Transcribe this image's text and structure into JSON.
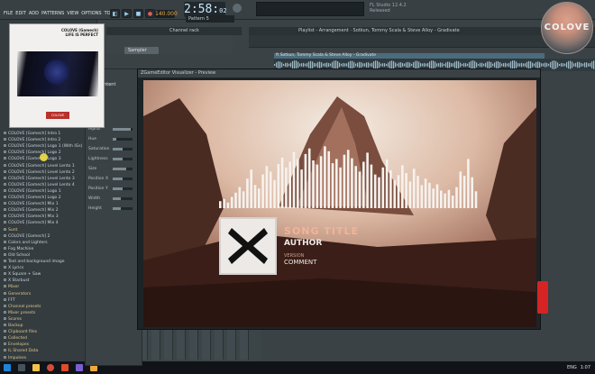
{
  "window": {
    "menu": [
      "FILE",
      "EDIT",
      "ADD",
      "PATTERNS",
      "VIEW",
      "OPTIONS",
      "TOOLS",
      "?"
    ],
    "tempo": "140.000",
    "time": "2:58:",
    "time_sub": "02",
    "pattern": "Pattern 5",
    "version_line1": "FL Studio 12.4.2",
    "version_line2": "Released"
  },
  "logo": {
    "text": "COLOVE"
  },
  "cover": {
    "title_line1": "COLOVE (Gamech)",
    "title_line2": "LIFE IS PERFECT",
    "badge": "COLOVE"
  },
  "channel_rack": {
    "title": "Channel rack",
    "sampler": "Sampler"
  },
  "playlist": {
    "title": "Playlist - Arrangement · Sotkun, Tommy Scala & Steve Alloy - Gradivate",
    "clip": "ft Sotkun, Tommy Scala & Steve Alloy - Gradivate"
  },
  "browser": {
    "items": [
      {
        "label": "COLOVE [Gamech] Intro 1",
        "folder": false
      },
      {
        "label": "COLOVE [Gamech] Intro 2",
        "folder": false
      },
      {
        "label": "COLOVE [Gamech] Logo 1 (With IGs)",
        "folder": false
      },
      {
        "label": "COLOVE [Gamech] Logo 2",
        "folder": false
      },
      {
        "label": "COLOVE [Gamech] Logo 3",
        "folder": false
      },
      {
        "label": "COLOVE [Gamech] Level Lento 1",
        "folder": false
      },
      {
        "label": "COLOVE [Gamech] Level Lento 2",
        "folder": false
      },
      {
        "label": "COLOVE [Gamech] Level Lento 3",
        "folder": false
      },
      {
        "label": "COLOVE [Gamech] Level Lento 4",
        "folder": false
      },
      {
        "label": "COLOVE [Gamech] Logo 1",
        "folder": false
      },
      {
        "label": "COLOVE [Gamech] Logo 2",
        "folder": false
      },
      {
        "label": "COLOVE [Gamech] Mix 1",
        "folder": false
      },
      {
        "label": "COLOVE [Gamech] Mix 2",
        "folder": false
      },
      {
        "label": "COLOVE [Gamech] Mix 3",
        "folder": false
      },
      {
        "label": "COLOVE [Gamech] Mix 4",
        "folder": false
      },
      {
        "label": "Sunt",
        "folder": true
      },
      {
        "label": "COLOVE [Gamech] 2",
        "folder": false
      },
      {
        "label": "Colors and Lighters",
        "folder": false
      },
      {
        "label": "Fog Machine",
        "folder": false
      },
      {
        "label": "Old School",
        "folder": false
      },
      {
        "label": "Text and background image",
        "folder": false
      },
      {
        "label": "X Lyrics",
        "folder": false
      },
      {
        "label": "X Square + Saw",
        "folder": false
      },
      {
        "label": "X Starbust",
        "folder": false
      },
      {
        "label": "Mixer",
        "folder": true
      },
      {
        "label": "Generators",
        "folder": true
      },
      {
        "label": "FFT",
        "folder": false
      },
      {
        "label": "Channel presets",
        "folder": true
      },
      {
        "label": "Mixer presets",
        "folder": true
      },
      {
        "label": "Scores",
        "folder": true
      },
      {
        "label": "Backup",
        "folder": true
      },
      {
        "label": "Clipboard files",
        "folder": true
      },
      {
        "label": "Collected",
        "folder": true
      },
      {
        "label": "Envelopes",
        "folder": true
      },
      {
        "label": "IL Shared Data",
        "folder": true
      },
      {
        "label": "Impulses",
        "folder": true
      }
    ]
  },
  "fx_panel": {
    "title": "ZGameEditor Visualizer",
    "add_content": "Add content",
    "rows": [
      {
        "label": "Alpha",
        "value": 0.9
      },
      {
        "label": "Hue",
        "value": 0.2
      },
      {
        "label": "Saturation",
        "value": 0.5
      },
      {
        "label": "Lightness",
        "value": 0.5
      },
      {
        "label": "Size",
        "value": 0.7
      },
      {
        "label": "Position X",
        "value": 0.5
      },
      {
        "label": "Position Y",
        "value": 0.5
      },
      {
        "label": "Width",
        "value": 0.4
      },
      {
        "label": "Height",
        "value": 0.4
      }
    ]
  },
  "preview": {
    "title": "ZGameEditor Visualizer - Preview",
    "song_title": "SONG TITLE",
    "author": "AUTHOR",
    "version": "VERSION",
    "comment": "COMMENT",
    "bars": [
      0.1,
      0.13,
      0.08,
      0.16,
      0.22,
      0.3,
      0.24,
      0.42,
      0.55,
      0.33,
      0.28,
      0.48,
      0.6,
      0.52,
      0.4,
      0.63,
      0.72,
      0.58,
      0.66,
      0.8,
      0.7,
      0.55,
      0.77,
      0.85,
      0.68,
      0.62,
      0.74,
      0.88,
      0.81,
      0.64,
      0.7,
      0.58,
      0.76,
      0.83,
      0.71,
      0.6,
      0.52,
      0.66,
      0.79,
      0.62,
      0.48,
      0.44,
      0.58,
      0.69,
      0.54,
      0.4,
      0.47,
      0.61,
      0.5,
      0.38,
      0.56,
      0.46,
      0.33,
      0.42,
      0.36,
      0.28,
      0.34,
      0.25,
      0.21,
      0.26,
      0.18,
      0.3,
      0.52,
      0.46,
      0.7,
      0.44,
      0.24
    ]
  },
  "tray": {
    "lang": "ENG",
    "time": "1:07"
  }
}
